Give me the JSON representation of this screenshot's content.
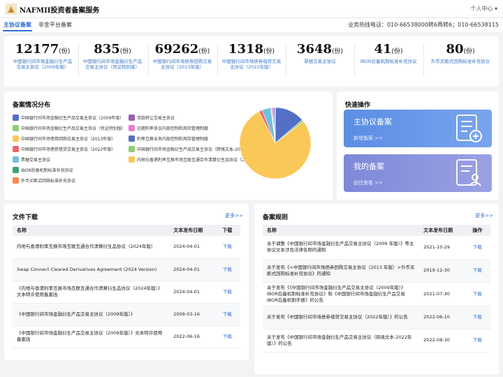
{
  "header": {
    "brand": "NAFMII投资者备案服务",
    "user_menu": "个人中心 ▾"
  },
  "nav": {
    "tabs": [
      {
        "label": "主协议备案",
        "active": true
      },
      {
        "label": "非金平台备案",
        "active": false
      }
    ],
    "hotline": "业务热线电话：010-66538000转6再转6；010-66538115"
  },
  "stats": [
    {
      "value": "12177",
      "unit": "(份)",
      "label": "中国银行间市场金融衍生产品交易主协议（2009年版）"
    },
    {
      "value": "835",
      "unit": "(份)",
      "label": "中国银行间市场金融衍生产品交易主协议（凭证特别版）"
    },
    {
      "value": "69262",
      "unit": "(份)",
      "label": "中国银行间市场债券回购交易主协议（2013年版）"
    },
    {
      "value": "1318",
      "unit": "(份)",
      "label": "中国银行间市场债券借贷交易主协议（2022年版）"
    },
    {
      "value": "3648",
      "unit": "(份)",
      "label": "票据交易主协议"
    },
    {
      "value": "41",
      "unit": "(份)",
      "label": "IBOR后备机制标准补充协议"
    },
    {
      "value": "80",
      "unit": "(份)",
      "label": "外币买断式回购标准补充协议"
    }
  ],
  "distribution": {
    "title": "备案情况分布",
    "legend": [
      {
        "label": "中国银行间市场金融衍生产品交易主协议（2009年版）",
        "color": "#5470c6"
      },
      {
        "label": "中国银行间市场金融衍生产品交易主协议（凭证特别版）",
        "color": "#91cc75"
      },
      {
        "label": "中国银行间市场债券回购交易主协议（2013年版）",
        "color": "#fac858"
      },
      {
        "label": "中国银行间市场债券借贷交易主协议（2022年版）",
        "color": "#ee6666"
      },
      {
        "label": "票据交易主协议",
        "color": "#73c0de"
      },
      {
        "label": "IBOR后备机制标准补充协议",
        "color": "#3ba272"
      },
      {
        "label": "外币买断式回购标准补充协议",
        "color": "#fc8452"
      },
      {
        "label": "贷款转让交易主协议",
        "color": "#9a60b4"
      },
      {
        "label": "远期利率协议内部控制和风险管理制度",
        "color": "#ea7ccc"
      },
      {
        "label": "利率互换业务内部控制和风险管理制度",
        "color": "#5470c6"
      },
      {
        "label": "中国银行间市场金融衍生产品交易主协议（跨境文本-2022年版）",
        "color": "#91cc75"
      },
      {
        "label": "内地与香港利率互换市场互联互通合作清算衍生品协议（2024年版）",
        "color": "#fac858"
      }
    ]
  },
  "chart_data": {
    "type": "pie",
    "slices": [
      {
        "value": 12177,
        "color": "#5470c6"
      },
      {
        "value": 835,
        "color": "#91cc75"
      },
      {
        "value": 69262,
        "color": "#fac858"
      },
      {
        "value": 1318,
        "color": "#ee6666"
      },
      {
        "value": 3648,
        "color": "#73c0de"
      },
      {
        "value": 41,
        "color": "#3ba272"
      },
      {
        "value": 80,
        "color": "#fc8452"
      },
      {
        "value": 300,
        "color": "#9a60b4"
      },
      {
        "value": 600,
        "color": "#ea7ccc"
      },
      {
        "value": 600,
        "color": "#5470c6"
      },
      {
        "value": 100,
        "color": "#91cc75"
      },
      {
        "value": 60,
        "color": "#fac858"
      }
    ]
  },
  "quick": {
    "title": "快速操作",
    "cards": [
      {
        "title": "主协议备案",
        "link": "新增备案 >>"
      },
      {
        "title": "我的备案",
        "link": "前往查看 >>"
      }
    ]
  },
  "files": {
    "title": "文件下载",
    "more": "更多>>",
    "columns": [
      "名称",
      "文本发布日期",
      "下载"
    ],
    "rows": [
      {
        "name": "内地与香港利率互换市场互联互通合作清算衍生品协议（2024年版）",
        "date": "2024-04-01",
        "action": "下载"
      },
      {
        "name": "Swap Connect Cleared Derivatives Agreement (2024 Version)",
        "date": "2024-04-01",
        "action": "下载"
      },
      {
        "name": "《内地与香港利率互换市场互联互通合作清算衍生品协议（2024年版）》文本特许使用备案函",
        "date": "2024-04-01",
        "action": "下载"
      },
      {
        "name": "《中国银行间市场金融衍生产品交易主协议（2009年版）》",
        "date": "2009-03-16",
        "action": "下载"
      },
      {
        "name": "《中国银行间市场金融衍生产品交易主协议（2009年版）》文本特许使用备案函",
        "date": "2022-06-16",
        "action": "下载"
      }
    ]
  },
  "rules": {
    "title": "备案规则",
    "more": "更多>>",
    "columns": [
      "名称",
      "文本发布日期",
      "操作"
    ],
    "rows": [
      {
        "name": "关于调整《中国银行间市场金融衍生产品交易主协议（2009 年版）》等主协议文本涉及法律名称的通知",
        "date": "2021-10-29",
        "action": "下载"
      },
      {
        "name": "关于发布《<中国银行间市场债券回购交易主协议（2013 年版）>外币买断式回购标准补充协议》的通知",
        "date": "2019-12-30",
        "action": "下载"
      },
      {
        "name": "关于发布《《中国银行间市场金融衍生产品交易主协议（2009年版）》IBOR后备机制标准补充协议》和《中国银行间市场金融衍生产品交易IBOR后备机制手册》的公告",
        "date": "2021-07-30",
        "action": "下载"
      },
      {
        "name": "关于发布《中国银行间市场债券借贷交易主协议（2022年版）》的公告",
        "date": "2022-06-10",
        "action": "下载"
      },
      {
        "name": "关于发布《中国银行间市场金融衍生产品交易主协议（跨境文本-2022年版）》的公告",
        "date": "2022-08-30",
        "action": "下载"
      }
    ]
  }
}
